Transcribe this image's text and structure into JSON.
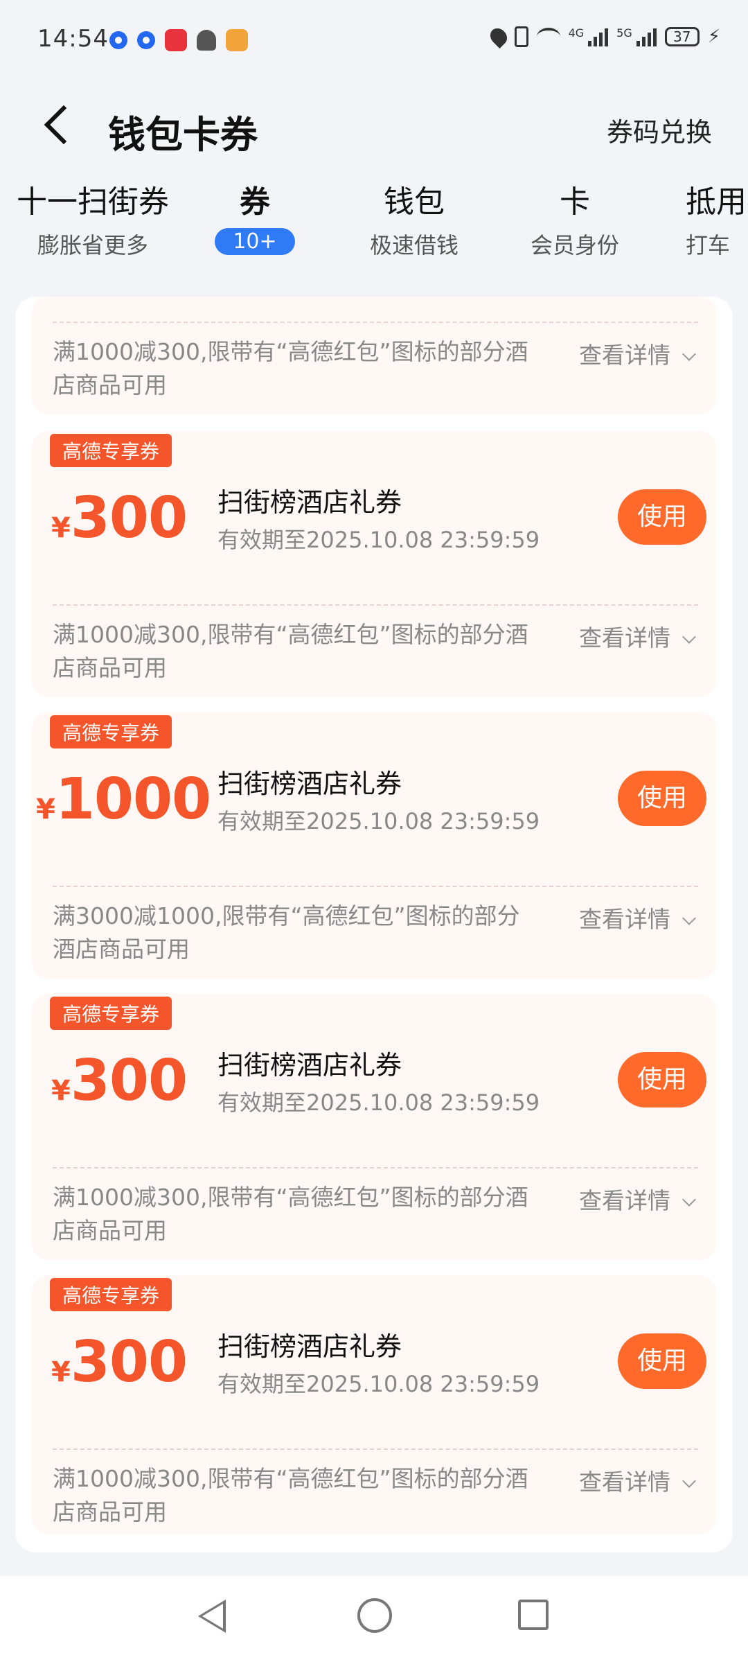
{
  "status_bar": {
    "time": "14:54",
    "sig1_label": "4G",
    "sig2_label": "5G",
    "battery": "37"
  },
  "header": {
    "title": "钱包卡券",
    "redeem": "券码兑换"
  },
  "tabs": [
    {
      "title": "十一扫街券",
      "sub": "膨胀省更多"
    },
    {
      "title": "券",
      "badge": "10+"
    },
    {
      "title": "钱包",
      "sub": "极速借钱"
    },
    {
      "title": "卡",
      "sub": "会员身份"
    },
    {
      "title": "抵用券",
      "sub": "打车"
    }
  ],
  "partial_card": {
    "condition": "满1000减300,限带有“高德红包”图标的部分酒店商品可用",
    "detail": "查看详情"
  },
  "coupons": [
    {
      "tag": "高德专享券",
      "currency": "¥",
      "amount": "300",
      "name": "扫街榜酒店礼券",
      "validity": "有效期至2025.10.08 23:59:59",
      "use": "使用",
      "condition": "满1000减300,限带有“高德红包”图标的部分酒店商品可用",
      "detail": "查看详情"
    },
    {
      "tag": "高德专享券",
      "currency": "¥",
      "amount": "1000",
      "name": "扫街榜酒店礼券",
      "validity": "有效期至2025.10.08 23:59:59",
      "use": "使用",
      "condition": "满3000减1000,限带有“高德红包”图标的部分酒店商品可用",
      "detail": "查看详情"
    },
    {
      "tag": "高德专享券",
      "currency": "¥",
      "amount": "300",
      "name": "扫街榜酒店礼券",
      "validity": "有效期至2025.10.08 23:59:59",
      "use": "使用",
      "condition": "满1000减300,限带有“高德红包”图标的部分酒店商品可用",
      "detail": "查看详情"
    },
    {
      "tag": "高德专享券",
      "currency": "¥",
      "amount": "300",
      "name": "扫街榜酒店礼券",
      "validity": "有效期至2025.10.08 23:59:59",
      "use": "使用",
      "condition": "满1000减300,限带有“高德红包”图标的部分酒店商品可用",
      "detail": "查看详情"
    }
  ],
  "colors": {
    "accent": "#F4552B",
    "button": "#FF6A2B",
    "tab_badge": "#2F7BF5"
  }
}
